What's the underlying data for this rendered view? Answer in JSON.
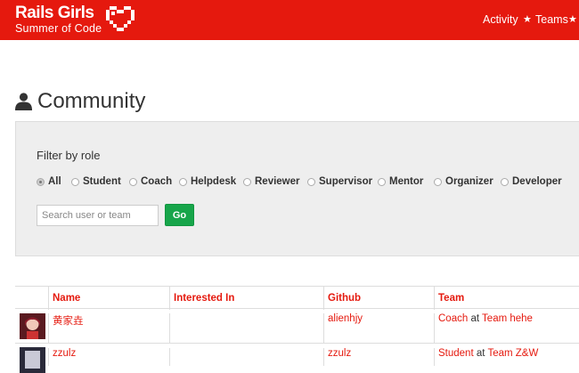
{
  "header": {
    "logo_title": "Rails Girls",
    "logo_subtitle": "Summer of Code",
    "nav": [
      {
        "label": "Activity"
      },
      {
        "label": "Teams"
      }
    ],
    "nav_separator": "★",
    "brand_color": "#e5190e"
  },
  "page": {
    "title": "Community",
    "title_icon": "user-icon"
  },
  "filter": {
    "label": "Filter by role",
    "roles": [
      "All",
      "Student",
      "Coach",
      "Helpdesk",
      "Reviewer",
      "Supervisor",
      "Mentor",
      "Organizer",
      "Developer"
    ],
    "selected": "All",
    "search_placeholder": "Search user or team",
    "search_value": "",
    "go_label": "Go",
    "go_color": "#17a54a"
  },
  "table": {
    "headers": [
      "",
      "Name",
      "Interested In",
      "Github",
      "Team"
    ],
    "rows": [
      {
        "name": "黄家垚",
        "interested_in": "",
        "github": "alienhjy",
        "role": "Coach",
        "at": "at",
        "team": "Team hehe"
      },
      {
        "name": "zzulz",
        "interested_in": "",
        "github": "zzulz",
        "role": "Student",
        "at": "at",
        "team": "Team Z&W"
      }
    ]
  }
}
